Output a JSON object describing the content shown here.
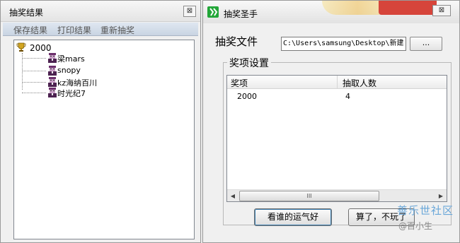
{
  "left_window": {
    "title": "抽奖结果",
    "close_glyph": "⊠",
    "menu": [
      "保存结果",
      "打印结果",
      "重新抽奖"
    ],
    "tree": {
      "root_label": "2000",
      "root_icon": "trophy-icon",
      "children": [
        "梁mars",
        "snopy",
        "kz海纳百川",
        "时光纪7"
      ],
      "child_icon": "user-avatar-icon"
    }
  },
  "right_window": {
    "title": "抽奖圣手",
    "close_glyph": "⊠",
    "file_label": "抽奖文件",
    "file_path": "C:\\Users\\samsung\\Desktop\\新建",
    "browse_label": "...",
    "group_label": "奖项设置",
    "columns": [
      "奖项",
      "抽取人数"
    ],
    "rows": [
      [
        "2000",
        "4"
      ]
    ],
    "scrollbar": {
      "left": "◀",
      "right": "▶",
      "thumb": "III"
    },
    "button_luck": "看谁的运气好",
    "button_quit": "算了，不玩了"
  },
  "watermark": {
    "line1": "善乐世社区",
    "line2": "@百小生"
  },
  "colors": {
    "list_border": "#828790",
    "watermark": "#6aa7d9",
    "app_icon": "#22a638"
  }
}
